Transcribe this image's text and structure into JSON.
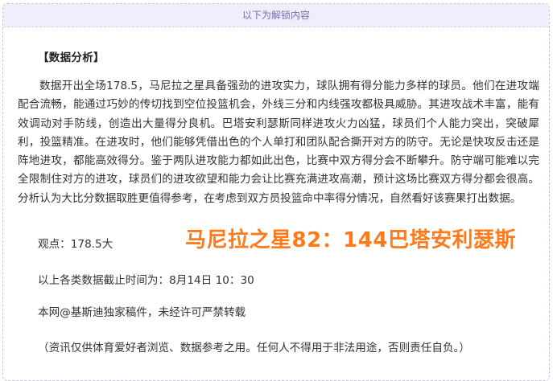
{
  "unlock_banner": "以下为解锁内容",
  "section_title": "【数据分析】",
  "analysis_text": "数据开出全场178.5，马尼拉之星具备强劲的进攻实力，球队拥有得分能力多样的球员。他们在进攻端配合流畅，能通过巧妙的传切找到空位投篮机会，外线三分和内线强攻都极具威胁。其进攻战术丰富，能有效调动对手防线，创造出大量得分良机。巴塔安利瑟斯同样进攻火力凶猛，球员们个人能力突出，突破犀利，投篮精准。在进攻时，他们能够凭借出色的个人单打和团队配合撕开对方的防守。无论是快攻反击还是阵地进攻，都能高效得分。鉴于两队进攻能力都如此出色，比赛中双方得分会不断攀升。防守端可能难以完全限制住对方的进攻，球员们的进攻欲望和能力会让比赛充满进攻高潮，预计这场比赛双方得分都会很高。分析认为大比分数据取胜更值得参考，在考虑到双方员投篮命中率得分情况，自然看好该赛果打出数据。",
  "viewpoint": "观点：178.5大",
  "score_prediction": "马尼拉之星82：144巴塔安利瑟斯",
  "cutoff_time": "以上各类数据截止时间为：8月14日 10：30",
  "copyright": "本网@基斯迪独家稿件，未经许可严禁转载",
  "disclaimer": "（资讯仅供体育爱好者浏览、数据参考之用。任何人不得用于非法用途，否则责任自负。）",
  "colors": {
    "accent_orange": "#ff7a1a",
    "banner_bg": "#f1eefb",
    "banner_text": "#7a6db3",
    "frame_border": "#c9c1e6"
  }
}
